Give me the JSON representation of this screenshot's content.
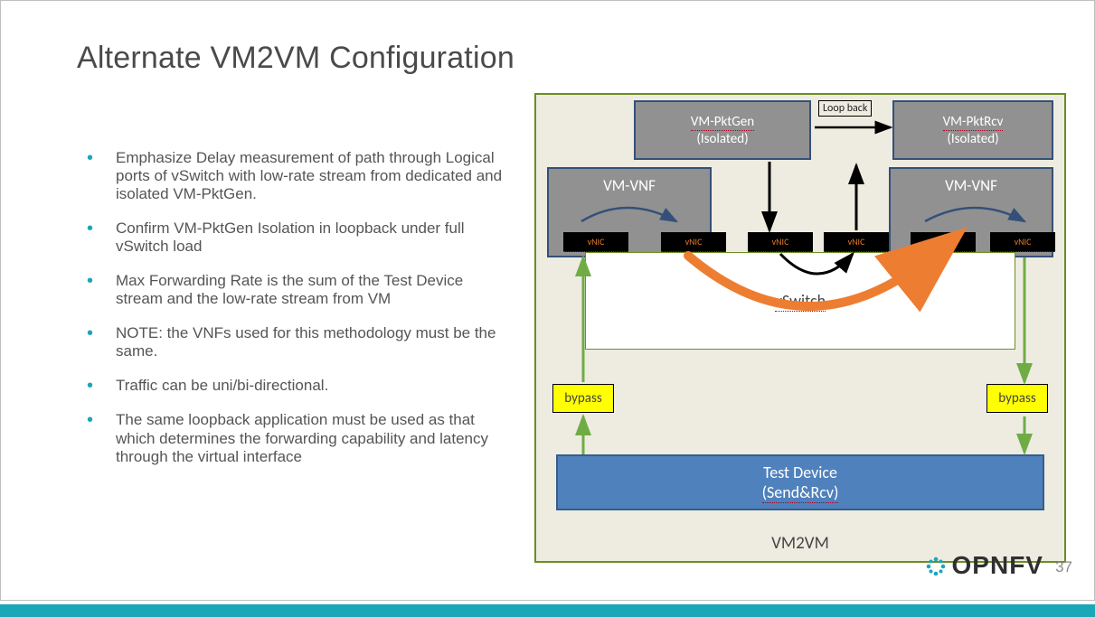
{
  "title": "Alternate VM2VM Configuration",
  "bullets": [
    "Emphasize Delay measurement of path through Logical ports of vSwitch with low-rate stream from dedicated and isolated VM-PktGen.",
    "Confirm VM-PktGen Isolation in loopback under full vSwitch load",
    "Max Forwarding Rate is the sum of the Test Device stream and the low-rate stream from VM",
    "NOTE: the VNFs used for this methodology must be the same.",
    "Traffic can be uni/bi-directional.",
    "The same loopback application must be used as that which determines the forwarding capability and latency through the virtual interface"
  ],
  "diagram": {
    "container_label": "VM2VM",
    "vswitch_label": "vSwitch",
    "test_device_line1": "Test Device",
    "test_device_line2": "(Send&Rcv)",
    "bypass_label": "bypass",
    "vm_vnf_label": "VM-VNF",
    "vm_pktgen_line1": "VM-PktGen",
    "vm_pktgen_line2": "(Isolated)",
    "vm_pktrcv_line1": "VM-PktRcv",
    "vm_pktrcv_line2": "(Isolated)",
    "loopback_label": "Loop back",
    "vnic_label": "vNIC"
  },
  "footer": {
    "page_number": "37",
    "logo_text": "OPNFV"
  },
  "colors": {
    "accent_teal": "#1aa7b8",
    "diagram_olive": "#6b8e23",
    "box_gray": "#919191",
    "box_blue": "#4f81bd",
    "bypass_yellow": "#ffff00",
    "orange_arrow": "#ed7d31",
    "green_arrow": "#6fac46"
  }
}
